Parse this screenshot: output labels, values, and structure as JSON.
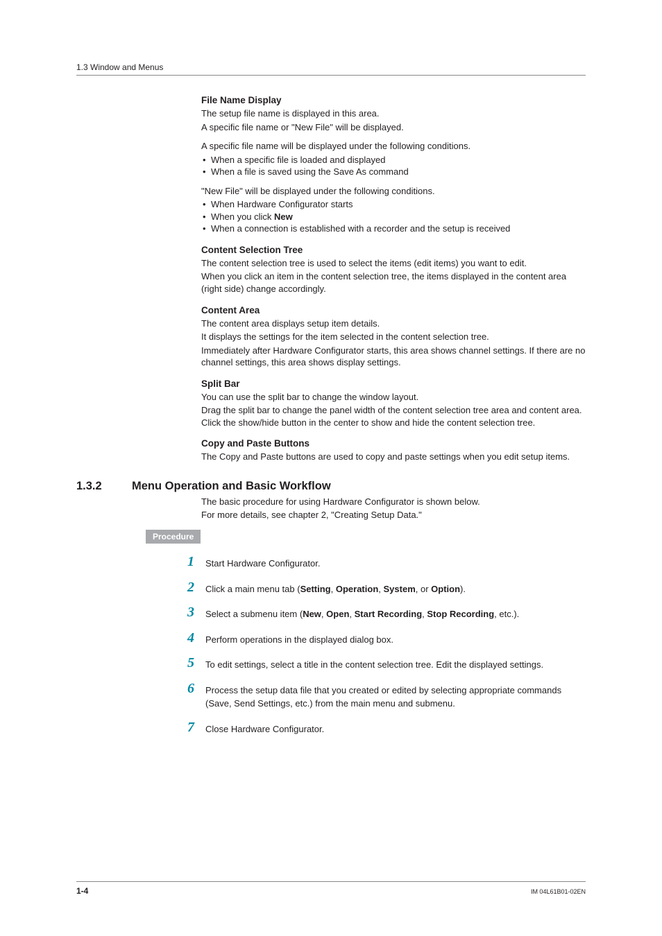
{
  "header": {
    "section_path": "1.3  Window and Menus"
  },
  "sections": {
    "file_name_display": {
      "title": "File Name Display",
      "p1": "The setup file name is displayed in this area.",
      "p2": "A specific file name or \"New File\" will be displayed.",
      "p3": "A specific file name will be displayed under the following conditions.",
      "bullets1": [
        "When a specific file is loaded and displayed",
        "When a file is saved using the Save As command"
      ],
      "p4": "\"New File\" will be displayed under the following conditions.",
      "bullets2_a": "When Hardware Configurator starts",
      "bullets2_b_pre": "When you click ",
      "bullets2_b_bold": "New",
      "bullets2_c": "When a connection is established with a recorder and the setup is received"
    },
    "content_selection_tree": {
      "title": "Content Selection Tree",
      "p1": "The content selection tree is used to select the items (edit items) you want to edit.",
      "p2": "When you click an item in the content selection tree, the items displayed in the content area (right side) change accordingly."
    },
    "content_area": {
      "title": "Content Area",
      "p1": "The content area displays setup item details.",
      "p2": "It displays the settings for the item selected in the content selection tree.",
      "p3": "Immediately after Hardware Configurator starts, this area shows channel settings. If there are no channel settings, this area shows display settings."
    },
    "split_bar": {
      "title": "Split Bar",
      "p1": "You can use the split bar to change the window layout.",
      "p2": "Drag the split bar to change the panel width of the content selection tree area and content area. Click the show/hide button in the center to show and hide the content selection tree."
    },
    "copy_paste": {
      "title": "Copy and Paste Buttons",
      "p1": "The Copy and Paste buttons are used to copy and paste settings when you edit setup items."
    }
  },
  "subsection": {
    "num": "1.3.2",
    "title": "Menu Operation and Basic Workflow",
    "intro1": "The basic procedure for using Hardware Configurator is shown below.",
    "intro2": "For more details, see chapter 2, \"Creating Setup Data.\""
  },
  "procedure_label": "Procedure",
  "steps": {
    "s1": {
      "n": "1",
      "text": "Start Hardware Configurator."
    },
    "s2": {
      "n": "2",
      "pre": "Click a main menu tab (",
      "b1": "Setting",
      "c1": ", ",
      "b2": "Operation",
      "c2": ", ",
      "b3": "System",
      "c3": ", or ",
      "b4": "Option",
      "post": ")."
    },
    "s3": {
      "n": "3",
      "pre": "Select a submenu item (",
      "b1": "New",
      "c1": ", ",
      "b2": "Open",
      "c2": ", ",
      "b3": "Start Recording",
      "c3": ", ",
      "b4": "Stop Recording",
      "post": ", etc.)."
    },
    "s4": {
      "n": "4",
      "text": "Perform operations in the displayed dialog box."
    },
    "s5": {
      "n": "5",
      "text": "To edit settings, select a title in the content selection tree. Edit the displayed settings."
    },
    "s6": {
      "n": "6",
      "text": "Process the setup data file that you created or edited by selecting appropriate commands (Save, Send Settings, etc.) from the main menu and submenu."
    },
    "s7": {
      "n": "7",
      "text": "Close Hardware Configurator."
    }
  },
  "footer": {
    "page": "1-4",
    "doc_id": "IM 04L61B01-02EN"
  }
}
